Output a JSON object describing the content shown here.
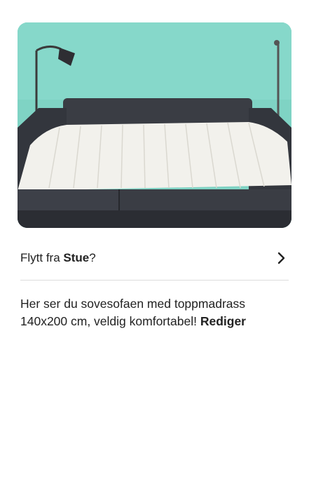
{
  "photo": {
    "alt": "Sovesofa med toppmadrass"
  },
  "move": {
    "prefix": "Flytt fra",
    "room": "Stue",
    "suffix": "?"
  },
  "caption": {
    "text": "Her ser du sovesofaen med toppmadrass 140x200 cm, veldig komfortabel!",
    "edit_label": "Rediger"
  },
  "colors": {
    "wall": "#7fd3c4",
    "sofa": "#3a3d44",
    "mattress": "#f2f1ec",
    "text": "#222222",
    "divider": "#dddddd"
  }
}
